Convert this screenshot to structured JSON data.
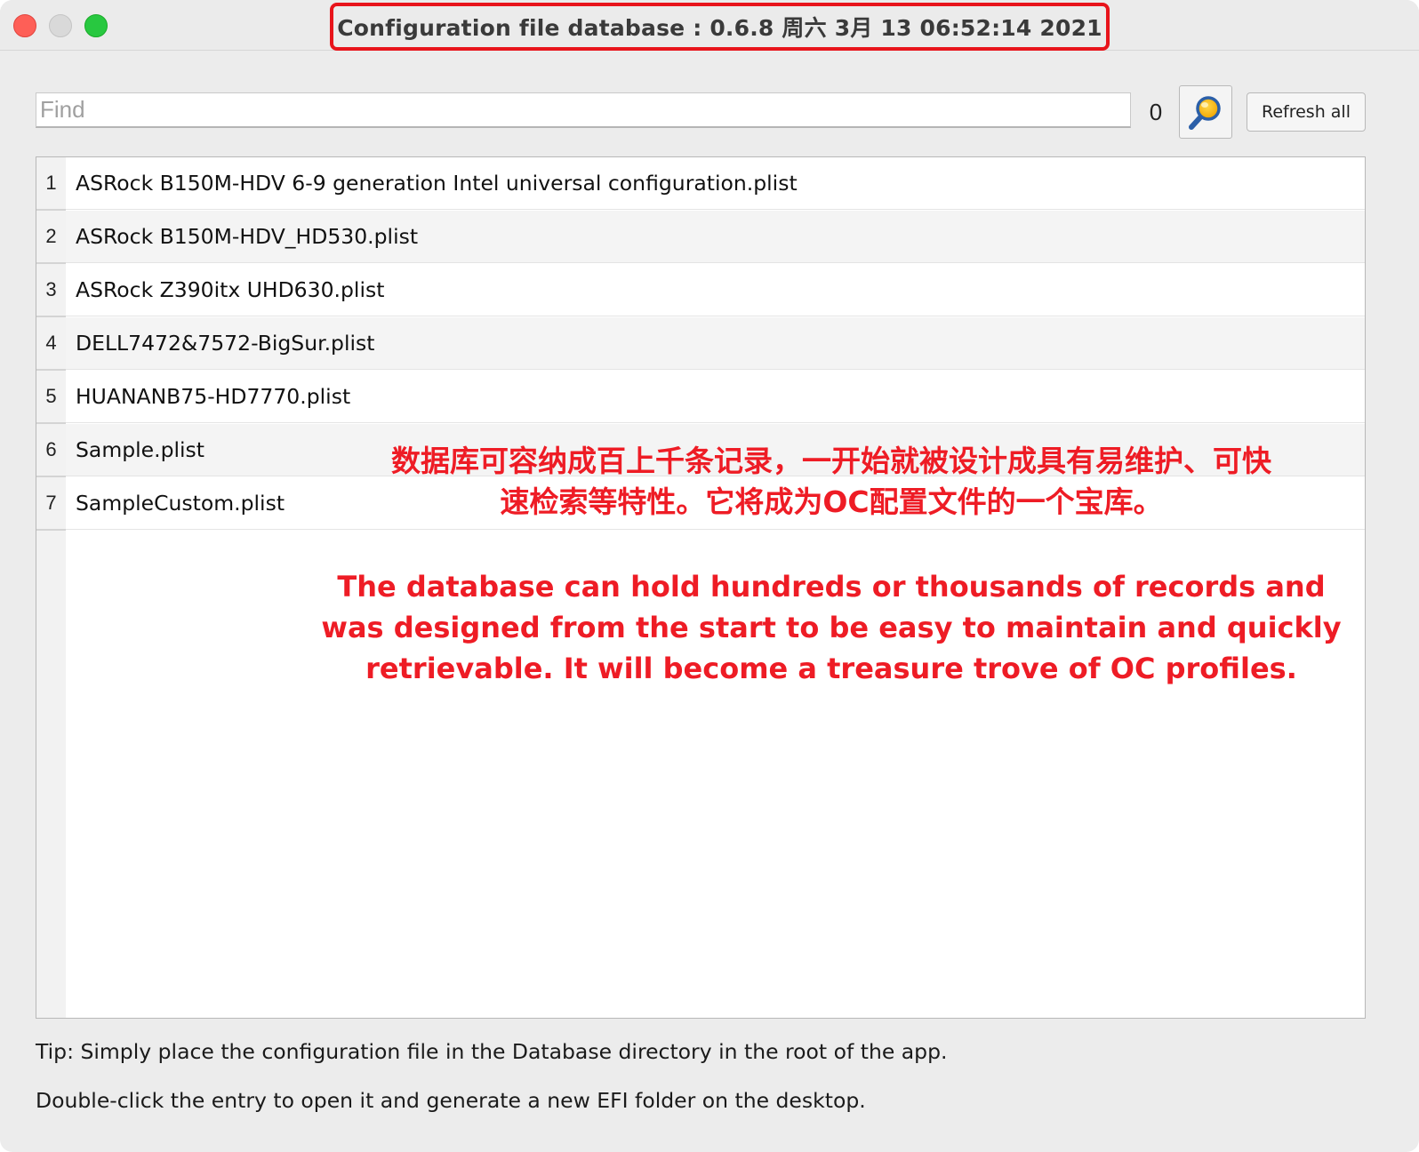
{
  "window": {
    "title": "Configuration file database : 0.6.8    周六 3月 13 06:52:14 2021"
  },
  "toolbar": {
    "find_placeholder": "Find",
    "find_value": "",
    "count": "0",
    "search_icon": "magnifier-icon",
    "refresh_label": "Refresh all"
  },
  "table": {
    "rows": [
      {
        "num": "1",
        "name": "ASRock B150M-HDV 6-9 generation Intel universal configuration.plist"
      },
      {
        "num": "2",
        "name": "ASRock B150M-HDV_HD530.plist"
      },
      {
        "num": "3",
        "name": "ASRock Z390itx UHD630.plist"
      },
      {
        "num": "4",
        "name": "DELL7472&7572-BigSur.plist"
      },
      {
        "num": "5",
        "name": "HUANANB75-HD7770.plist"
      },
      {
        "num": "6",
        "name": "Sample.plist"
      },
      {
        "num": "7",
        "name": "SampleCustom.plist"
      }
    ]
  },
  "annotation": {
    "cn_line1": "数据库可容纳成百上千条记录，一开始就被设计成具有易维护、可快",
    "cn_line2": "速检索等特性。它将成为OC配置文件的一个宝库。",
    "en_line1": "The database can hold hundreds or thousands of records and",
    "en_line2": "was designed from the start to be easy to maintain and quickly",
    "en_line3": "retrievable. It will become a treasure trove of OC profiles."
  },
  "footer": {
    "tip1": "Tip: Simply place the configuration file in the Database directory in the root of the app.",
    "tip2": "Double-click the entry to open it and generate a new EFI folder on the desktop."
  },
  "colors": {
    "highlight": "#e8141b",
    "annotation_text": "#ee1c25"
  }
}
